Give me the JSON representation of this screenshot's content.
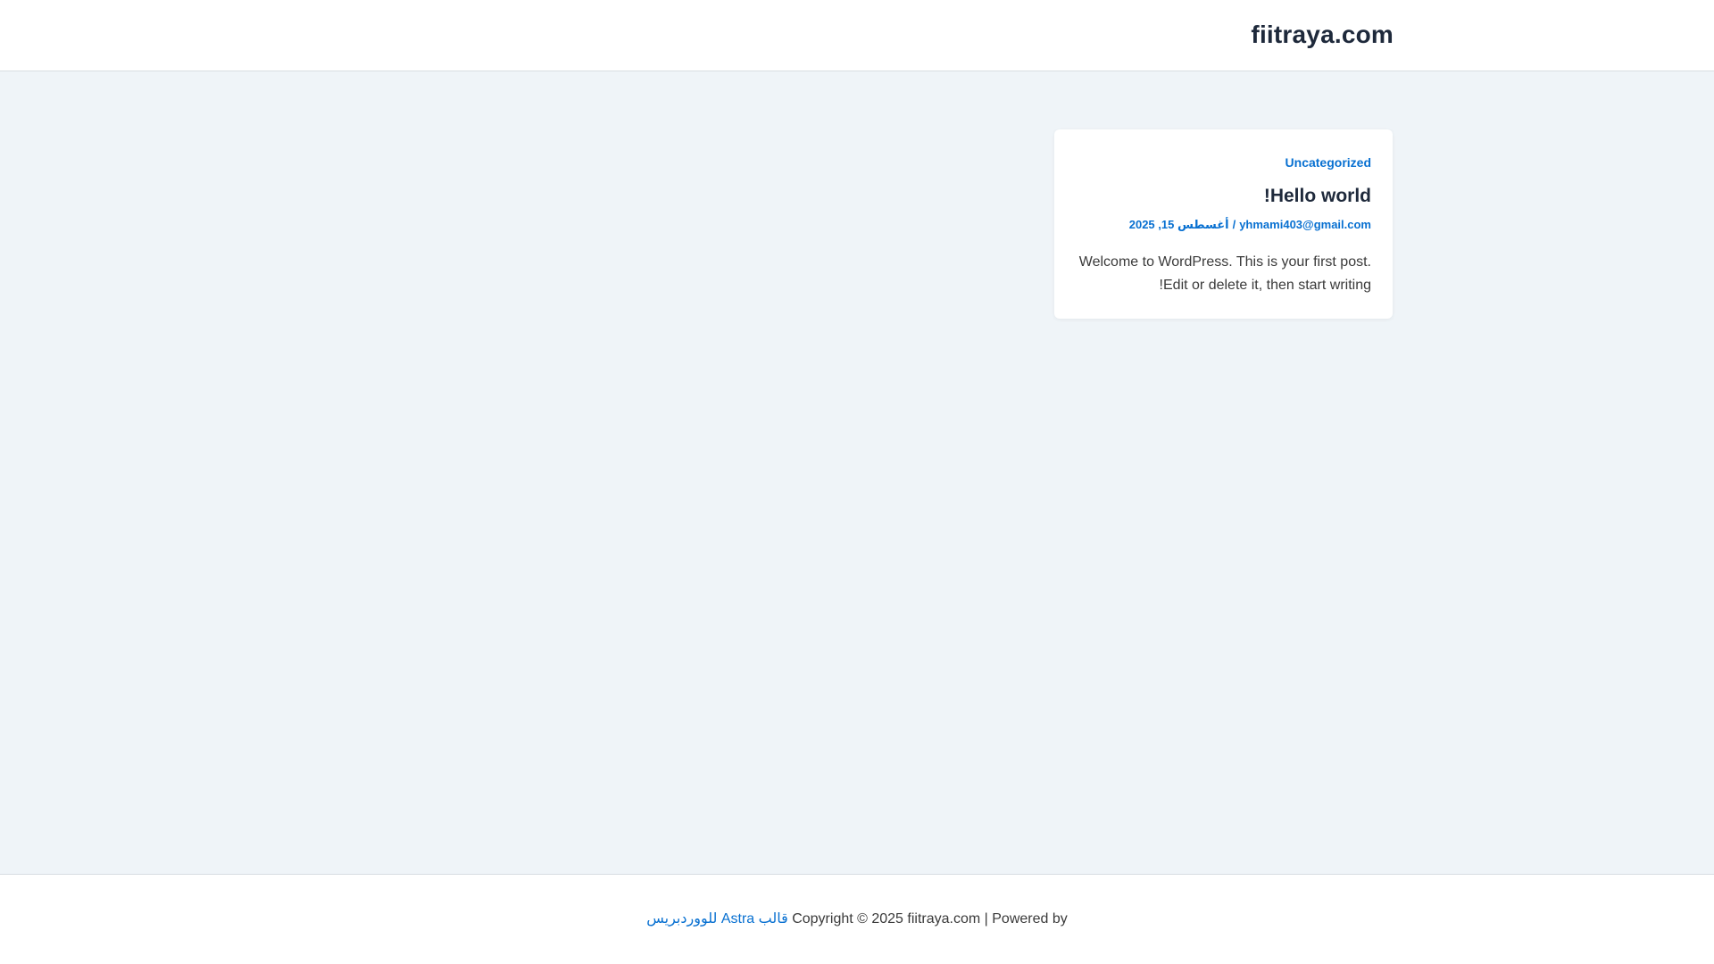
{
  "header": {
    "site_title": "fiitraya.com"
  },
  "post": {
    "category": "Uncategorized",
    "title": "Hello world!",
    "author": "yhmami403@gmail.com",
    "separator": "/",
    "date": "أغسطس 15, 2025",
    "excerpt_line1": "Welcome to WordPress. This is your first post.",
    "excerpt_line2": "Edit or delete it, then start writing!"
  },
  "footer": {
    "copyright_text": "Copyright © 2025 fiitraya.com | Powered by",
    "theme_link": "قالب Astra للووردبريس"
  },
  "colors": {
    "background": "#eff4f8",
    "surface": "#ffffff",
    "link": "#0870d1",
    "heading": "#1e293b",
    "text": "#3a3a3a"
  }
}
